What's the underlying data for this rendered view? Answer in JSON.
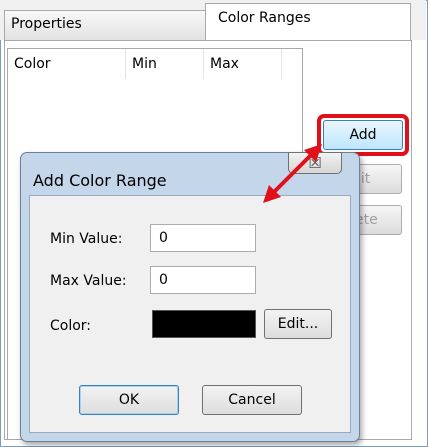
{
  "tabs": {
    "properties": "Properties",
    "color_ranges": "Color Ranges"
  },
  "list": {
    "columns": [
      "Color",
      "Min",
      "Max"
    ]
  },
  "side_buttons": {
    "add": "Add",
    "edit_partial": "lit",
    "delete_partial": "ete"
  },
  "dialog": {
    "title": "Add Color Range",
    "close_symbol": "☒",
    "min_label": "Min Value:",
    "min_value": "0",
    "max_label": "Max Value:",
    "max_value": "0",
    "color_label": "Color:",
    "color_value": "#000000",
    "edit_button": "Edit...",
    "ok_button": "OK",
    "cancel_button": "Cancel"
  },
  "colors": {
    "highlight": "#e0101b",
    "dialog_frame": "#c4d6ea"
  }
}
